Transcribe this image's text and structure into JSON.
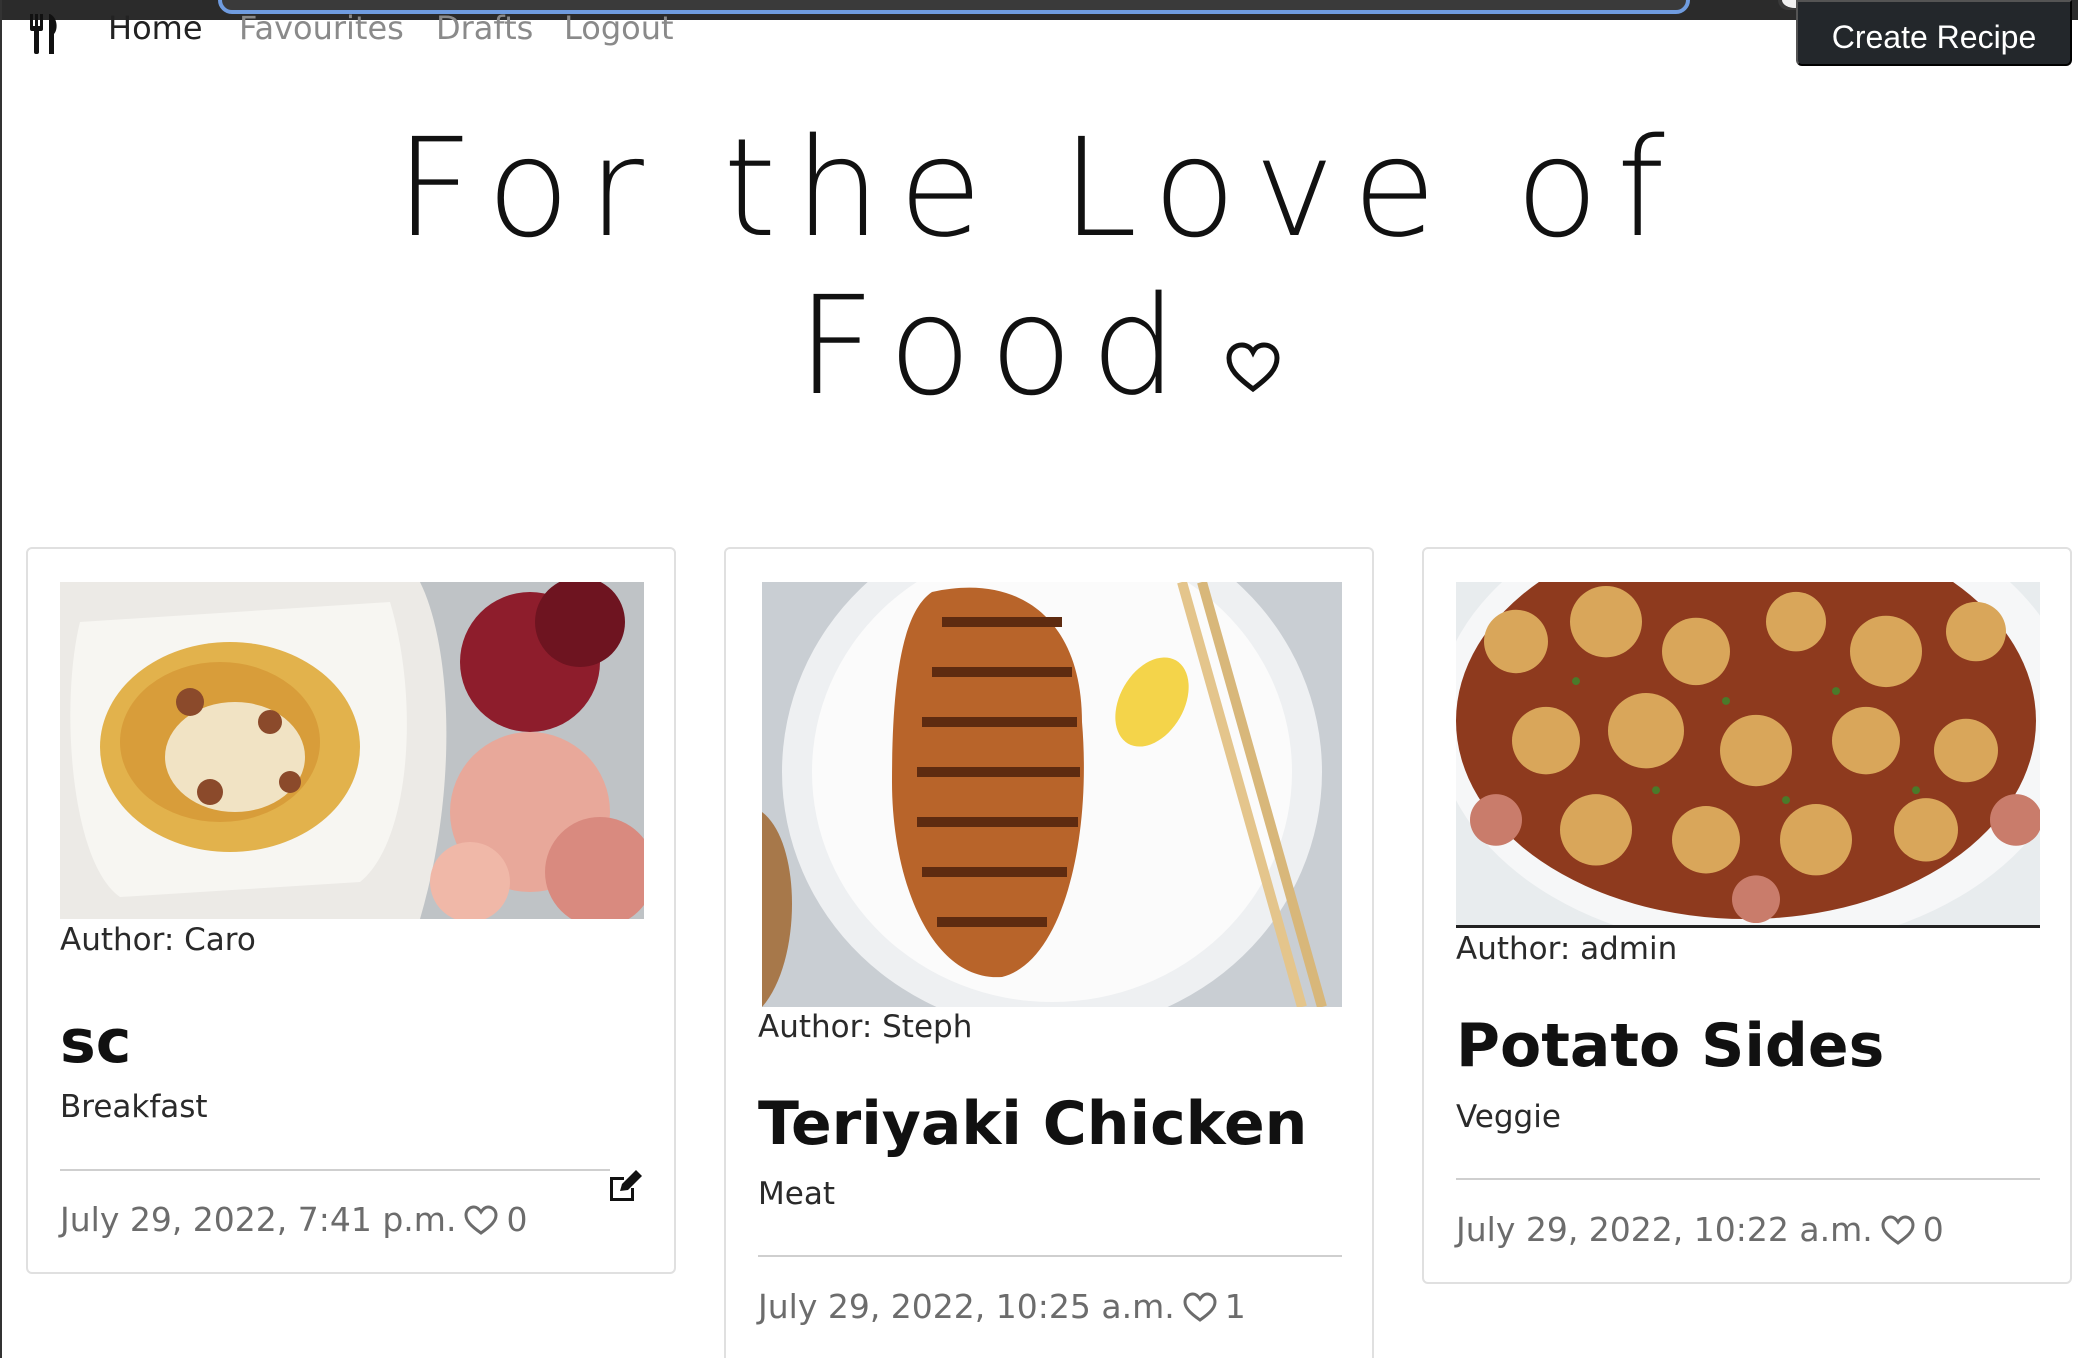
{
  "nav": {
    "brand_icon": "utensils-icon",
    "links": [
      {
        "label": "Home",
        "active": true
      },
      {
        "label": "Favourites",
        "active": false
      },
      {
        "label": "Drafts",
        "active": false
      },
      {
        "label": "Logout",
        "active": false
      }
    ],
    "create_button": "Create Recipe"
  },
  "hero": {
    "line1": "For the Love of",
    "line2": "Food",
    "icon": "heart-outline-icon"
  },
  "cards": [
    {
      "image": "pasta-carbonara-photo",
      "author": "Author: Caro",
      "title": "sc",
      "category": "Breakfast",
      "date": "July 29, 2022, 7:41 p.m.",
      "likes": "0",
      "editable": true
    },
    {
      "image": "teriyaki-chicken-photo",
      "author": "Author: Steph",
      "title": "Teriyaki Chicken",
      "category": "Meat",
      "date": "July 29, 2022, 10:25 a.m.",
      "likes": "1",
      "editable": false
    },
    {
      "image": "roasted-potatoes-photo",
      "author": "Author: admin",
      "title": "Potato Sides",
      "category": "Veggie",
      "date": "July 29, 2022, 10:22 a.m.",
      "likes": "0",
      "editable": false
    }
  ],
  "colors": {
    "create_button_bg": "#23272b",
    "nav_inactive": "#8a8a8a",
    "meta_text": "#6c6c6c"
  }
}
